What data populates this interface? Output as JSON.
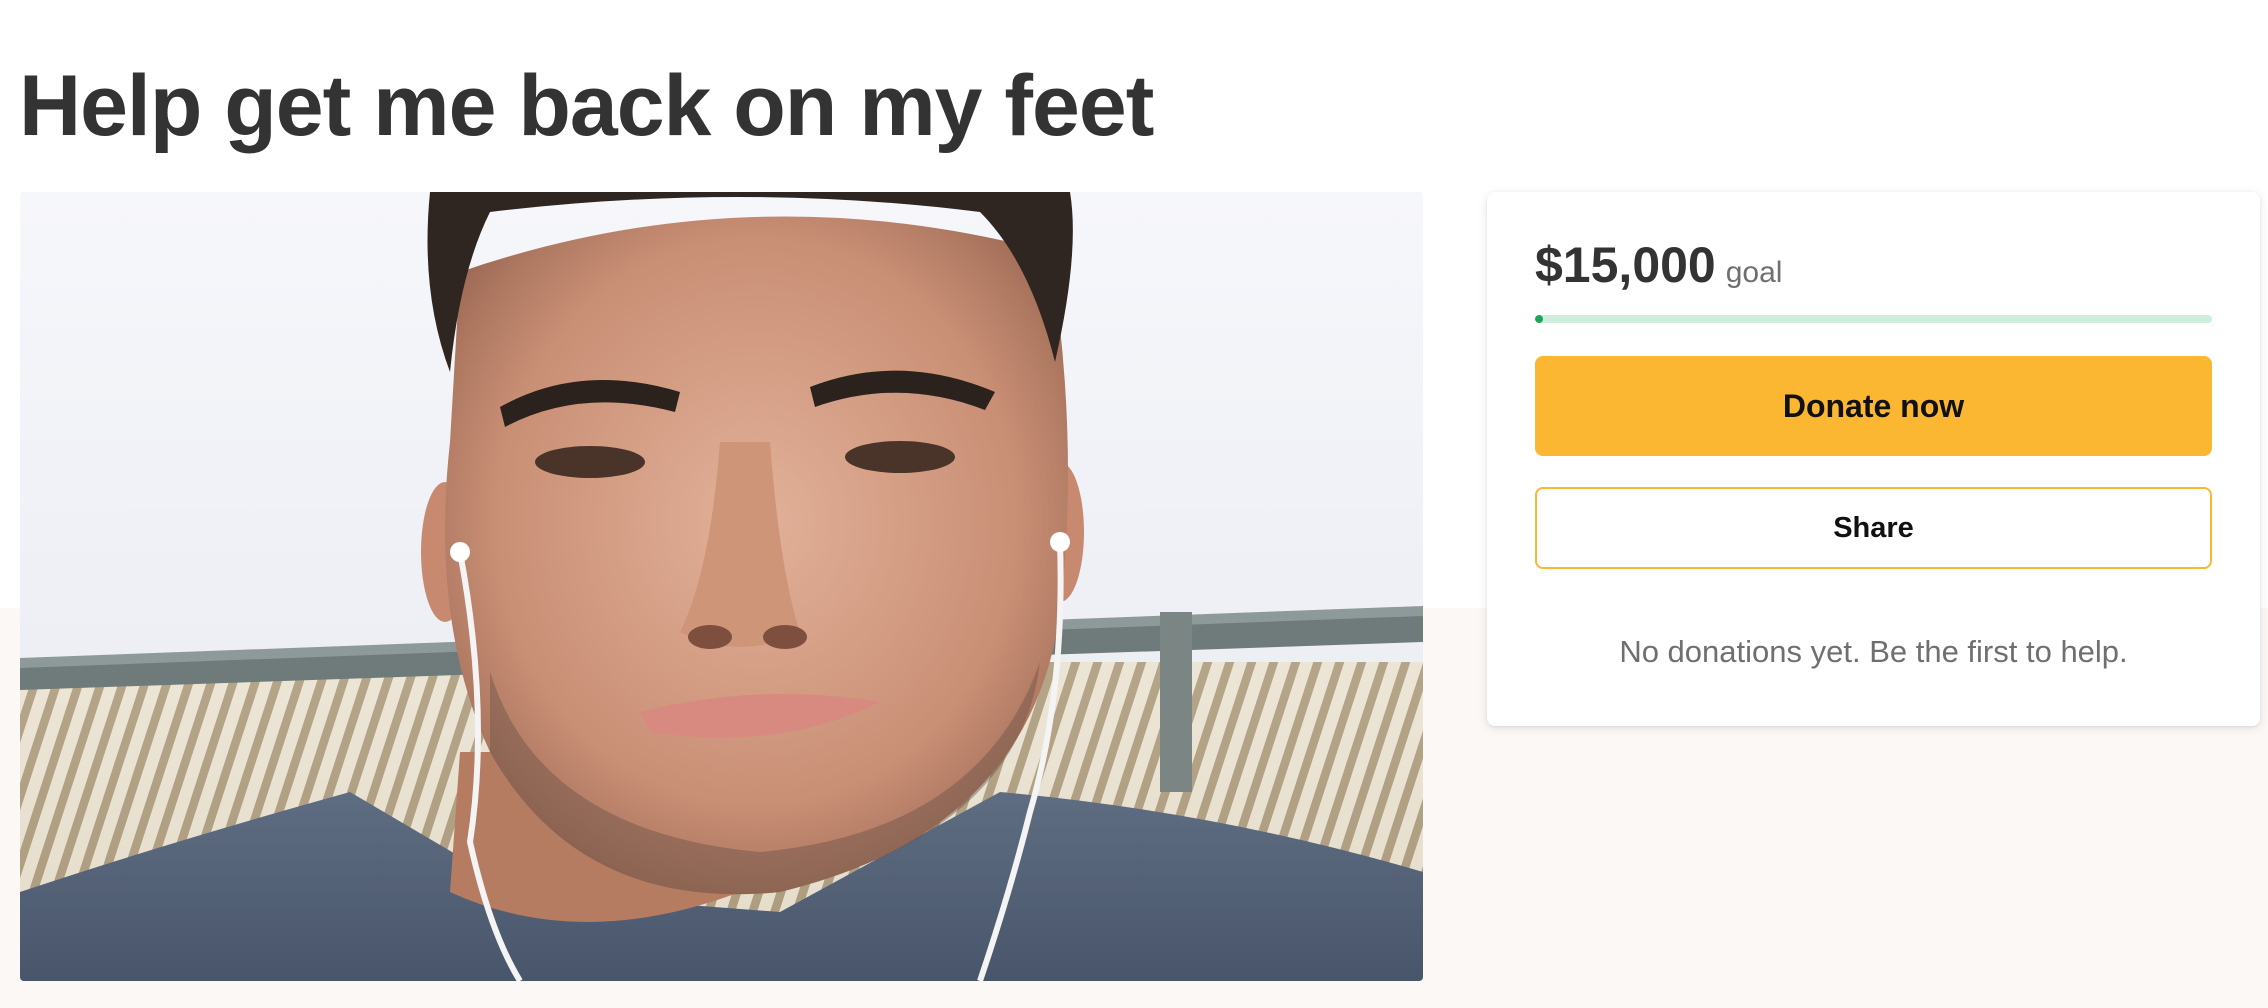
{
  "campaign": {
    "title": "Help get me back on my feet"
  },
  "hero": {
    "description": "Selfie of a man wearing white earbuds in front of a white slatted fence"
  },
  "donation_card": {
    "goal_amount": "$15,000",
    "goal_label": "goal",
    "progress_fraction": 0.005,
    "donate_label": "Donate now",
    "share_label": "Share",
    "empty_message": "No donations yet. Be the first to help."
  },
  "colors": {
    "accent": "#fbb731",
    "progress_track": "#cdeedd",
    "progress_fill": "#1fa55a",
    "title_text": "#333333",
    "muted_text": "#6f6f6f",
    "lower_background": "#fbf8f6"
  }
}
